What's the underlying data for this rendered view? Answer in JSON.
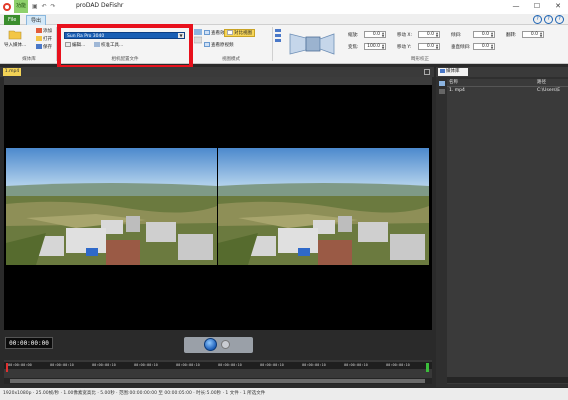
{
  "window": {
    "title": "proDAD DeFishr",
    "quick_tab": "功能",
    "minimize": "—",
    "maximize": "☐",
    "close": "✕"
  },
  "menu": {
    "tabs": [
      "File",
      "导出"
    ],
    "help": [
      "?",
      "?",
      "?"
    ]
  },
  "ribbon": {
    "media_group_label": "媒体库",
    "import_label": "导入媒体...",
    "small_cmds": [
      "添加",
      "打开",
      "保存"
    ],
    "camera_group_label": "相机配置文件",
    "camera_profile": "Sun Ra Pro 3040",
    "edit_label": "编辑...",
    "calibrate_label": "校准工具...",
    "view_group_label": "视图模式",
    "view_items": [
      "查看效果",
      "对比视图",
      "查看原视频"
    ],
    "distortion_group_label": "畸形校正",
    "fields": [
      {
        "label": "缩放:",
        "value": "0.0"
      },
      {
        "label": "变焦:",
        "value": "100.0"
      },
      {
        "label": "移动 X:",
        "value": "0.0"
      },
      {
        "label": "移动 Y:",
        "value": "0.0"
      },
      {
        "label": "倾斜:",
        "value": "0.0"
      },
      {
        "label": "垂直倾斜:",
        "value": "0.0"
      },
      {
        "label": "翻转:",
        "value": "0.0"
      }
    ]
  },
  "document": {
    "tab": "1.mp4"
  },
  "player": {
    "timecode": "00:00:00:00"
  },
  "timeline": {
    "ticks": [
      "00:00:00:00",
      "00:00:00:10",
      "00:00:00:10",
      "00:00:00:10",
      "00:00:00:10",
      "00:00:00:10",
      "00:00:00:10",
      "00:00:00:10",
      "00:00:00:10",
      "00:00:00:10"
    ]
  },
  "media_library": {
    "tab": "媒体库",
    "col_name": "名称",
    "col_path": "路径",
    "row_name": "1. mp4",
    "row_path": "C:\\Users\\E"
  },
  "status": "1920x1080p · 25.00帧/秒 · 1.00像素宽高比 · 5.00秒 · 范围:00:00:00:00 至 00:00:05:00 · 时长:5.00秒 · 1 文件 · 1 所选文件",
  "colors": {
    "highlight_box": "#e8101c",
    "accent_green": "#3a8d2c",
    "combo_blue": "#1a5fb4"
  }
}
